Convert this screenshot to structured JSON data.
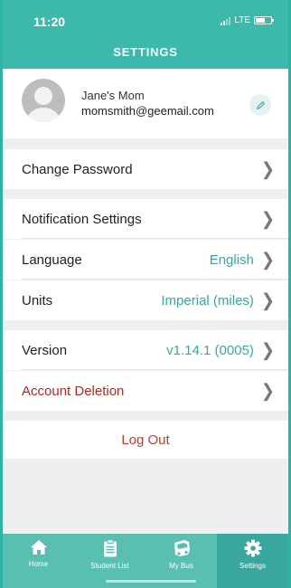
{
  "status": {
    "time": "11:20",
    "network": "LTE"
  },
  "header": {
    "title": "SETTINGS"
  },
  "profile": {
    "name": "Jane's Mom",
    "email": "momsmith@geemail.com"
  },
  "rows": {
    "change_password": {
      "label": "Change Password"
    },
    "notifications": {
      "label": "Notification Settings"
    },
    "language": {
      "label": "Language",
      "value": "English"
    },
    "units": {
      "label": "Units",
      "value": "Imperial (miles)"
    },
    "version": {
      "label": "Version",
      "value": "v1.14.1 (0005)"
    },
    "account_deletion": {
      "label": "Account Deletion"
    }
  },
  "logout": {
    "label": "Log Out"
  },
  "tabs": [
    {
      "label": "Home",
      "icon": "home-icon"
    },
    {
      "label": "Student List",
      "icon": "clipboard-icon"
    },
    {
      "label": "My Bus",
      "icon": "bus-icon"
    },
    {
      "label": "Settings",
      "icon": "gear-icon",
      "active": true
    }
  ],
  "colors": {
    "accent": "#3cb9aa",
    "tab_active": "#3aa79e",
    "value_text": "#3aa79e",
    "danger": "#b32a1f"
  }
}
